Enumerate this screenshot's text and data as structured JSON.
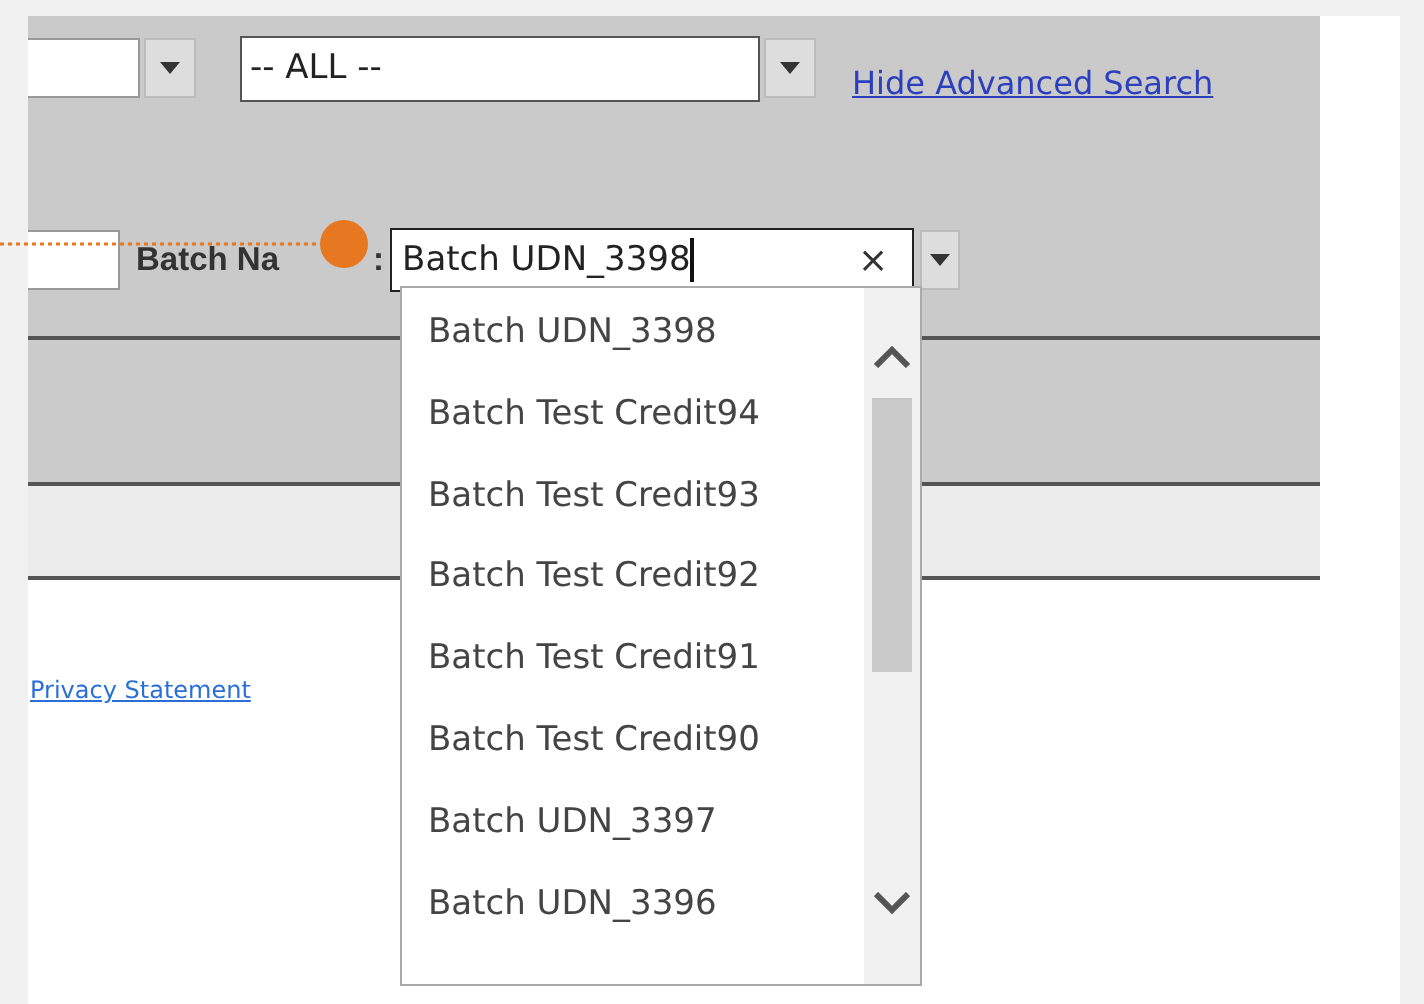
{
  "search_panel": {
    "status_select": {
      "value": "-- ALL --"
    },
    "hide_advanced_link": "Hide Advanced Search",
    "batch_name_label": "Batch Na",
    "batch_name_label_end": ":",
    "batch_name_field": {
      "value": "Batch UDN_3398",
      "clear": "×"
    }
  },
  "batch_dropdown": {
    "items": [
      {
        "label": "Batch UDN_3398",
        "selected": false
      },
      {
        "label": "Batch Test Credit94",
        "selected": false
      },
      {
        "label": "Batch Test Credit93",
        "selected": false
      },
      {
        "label": "Batch Test Credit92",
        "selected": false
      },
      {
        "label": "Batch Test Credit91",
        "selected": false
      },
      {
        "label": "Batch Test Credit90",
        "selected": false
      },
      {
        "label": "Batch UDN_3397",
        "selected": false
      },
      {
        "label": "Batch UDN_3396",
        "selected": false
      }
    ]
  },
  "footer": {
    "privacy_link": "Privacy Statement"
  }
}
